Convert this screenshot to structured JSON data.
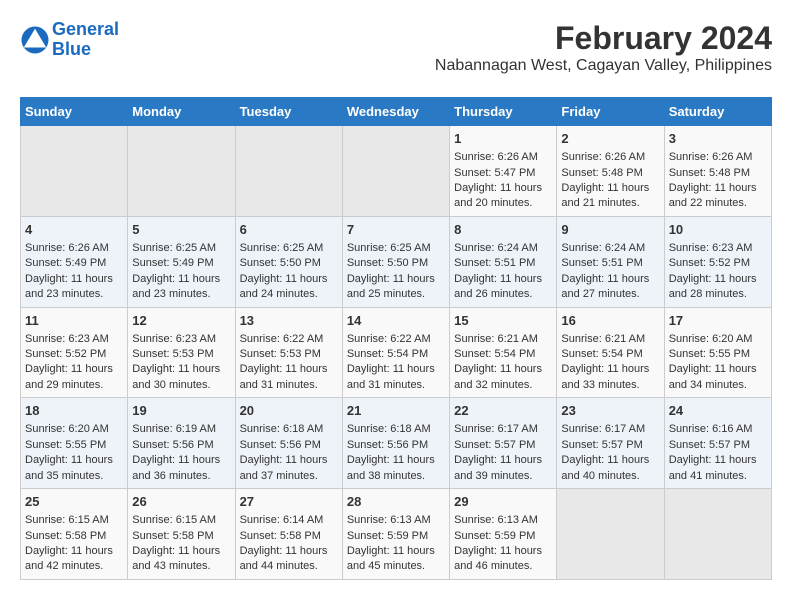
{
  "logo": {
    "line1": "General",
    "line2": "Blue"
  },
  "title": "February 2024",
  "subtitle": "Nabannagan West, Cagayan Valley, Philippines",
  "days_of_week": [
    "Sunday",
    "Monday",
    "Tuesday",
    "Wednesday",
    "Thursday",
    "Friday",
    "Saturday"
  ],
  "weeks": [
    [
      {
        "day": "",
        "content": ""
      },
      {
        "day": "",
        "content": ""
      },
      {
        "day": "",
        "content": ""
      },
      {
        "day": "",
        "content": ""
      },
      {
        "day": "1",
        "content": "Sunrise: 6:26 AM\nSunset: 5:47 PM\nDaylight: 11 hours\nand 20 minutes."
      },
      {
        "day": "2",
        "content": "Sunrise: 6:26 AM\nSunset: 5:48 PM\nDaylight: 11 hours\nand 21 minutes."
      },
      {
        "day": "3",
        "content": "Sunrise: 6:26 AM\nSunset: 5:48 PM\nDaylight: 11 hours\nand 22 minutes."
      }
    ],
    [
      {
        "day": "4",
        "content": "Sunrise: 6:26 AM\nSunset: 5:49 PM\nDaylight: 11 hours\nand 23 minutes."
      },
      {
        "day": "5",
        "content": "Sunrise: 6:25 AM\nSunset: 5:49 PM\nDaylight: 11 hours\nand 23 minutes."
      },
      {
        "day": "6",
        "content": "Sunrise: 6:25 AM\nSunset: 5:50 PM\nDaylight: 11 hours\nand 24 minutes."
      },
      {
        "day": "7",
        "content": "Sunrise: 6:25 AM\nSunset: 5:50 PM\nDaylight: 11 hours\nand 25 minutes."
      },
      {
        "day": "8",
        "content": "Sunrise: 6:24 AM\nSunset: 5:51 PM\nDaylight: 11 hours\nand 26 minutes."
      },
      {
        "day": "9",
        "content": "Sunrise: 6:24 AM\nSunset: 5:51 PM\nDaylight: 11 hours\nand 27 minutes."
      },
      {
        "day": "10",
        "content": "Sunrise: 6:23 AM\nSunset: 5:52 PM\nDaylight: 11 hours\nand 28 minutes."
      }
    ],
    [
      {
        "day": "11",
        "content": "Sunrise: 6:23 AM\nSunset: 5:52 PM\nDaylight: 11 hours\nand 29 minutes."
      },
      {
        "day": "12",
        "content": "Sunrise: 6:23 AM\nSunset: 5:53 PM\nDaylight: 11 hours\nand 30 minutes."
      },
      {
        "day": "13",
        "content": "Sunrise: 6:22 AM\nSunset: 5:53 PM\nDaylight: 11 hours\nand 31 minutes."
      },
      {
        "day": "14",
        "content": "Sunrise: 6:22 AM\nSunset: 5:54 PM\nDaylight: 11 hours\nand 31 minutes."
      },
      {
        "day": "15",
        "content": "Sunrise: 6:21 AM\nSunset: 5:54 PM\nDaylight: 11 hours\nand 32 minutes."
      },
      {
        "day": "16",
        "content": "Sunrise: 6:21 AM\nSunset: 5:54 PM\nDaylight: 11 hours\nand 33 minutes."
      },
      {
        "day": "17",
        "content": "Sunrise: 6:20 AM\nSunset: 5:55 PM\nDaylight: 11 hours\nand 34 minutes."
      }
    ],
    [
      {
        "day": "18",
        "content": "Sunrise: 6:20 AM\nSunset: 5:55 PM\nDaylight: 11 hours\nand 35 minutes."
      },
      {
        "day": "19",
        "content": "Sunrise: 6:19 AM\nSunset: 5:56 PM\nDaylight: 11 hours\nand 36 minutes."
      },
      {
        "day": "20",
        "content": "Sunrise: 6:18 AM\nSunset: 5:56 PM\nDaylight: 11 hours\nand 37 minutes."
      },
      {
        "day": "21",
        "content": "Sunrise: 6:18 AM\nSunset: 5:56 PM\nDaylight: 11 hours\nand 38 minutes."
      },
      {
        "day": "22",
        "content": "Sunrise: 6:17 AM\nSunset: 5:57 PM\nDaylight: 11 hours\nand 39 minutes."
      },
      {
        "day": "23",
        "content": "Sunrise: 6:17 AM\nSunset: 5:57 PM\nDaylight: 11 hours\nand 40 minutes."
      },
      {
        "day": "24",
        "content": "Sunrise: 6:16 AM\nSunset: 5:57 PM\nDaylight: 11 hours\nand 41 minutes."
      }
    ],
    [
      {
        "day": "25",
        "content": "Sunrise: 6:15 AM\nSunset: 5:58 PM\nDaylight: 11 hours\nand 42 minutes."
      },
      {
        "day": "26",
        "content": "Sunrise: 6:15 AM\nSunset: 5:58 PM\nDaylight: 11 hours\nand 43 minutes."
      },
      {
        "day": "27",
        "content": "Sunrise: 6:14 AM\nSunset: 5:58 PM\nDaylight: 11 hours\nand 44 minutes."
      },
      {
        "day": "28",
        "content": "Sunrise: 6:13 AM\nSunset: 5:59 PM\nDaylight: 11 hours\nand 45 minutes."
      },
      {
        "day": "29",
        "content": "Sunrise: 6:13 AM\nSunset: 5:59 PM\nDaylight: 11 hours\nand 46 minutes."
      },
      {
        "day": "",
        "content": ""
      },
      {
        "day": "",
        "content": ""
      }
    ]
  ]
}
